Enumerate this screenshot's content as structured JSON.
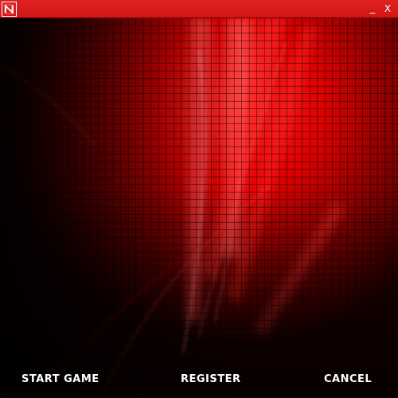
{
  "window": {
    "logo_letter": "N",
    "minimize_label": "_",
    "close_label": "X"
  },
  "menu": {
    "start_game": "START GAME",
    "register": "REGISTER",
    "cancel": "CANCEL"
  },
  "colors": {
    "titlebar": "#d91b1b",
    "accent": "#ff1a1a",
    "text": "#ffffff"
  }
}
